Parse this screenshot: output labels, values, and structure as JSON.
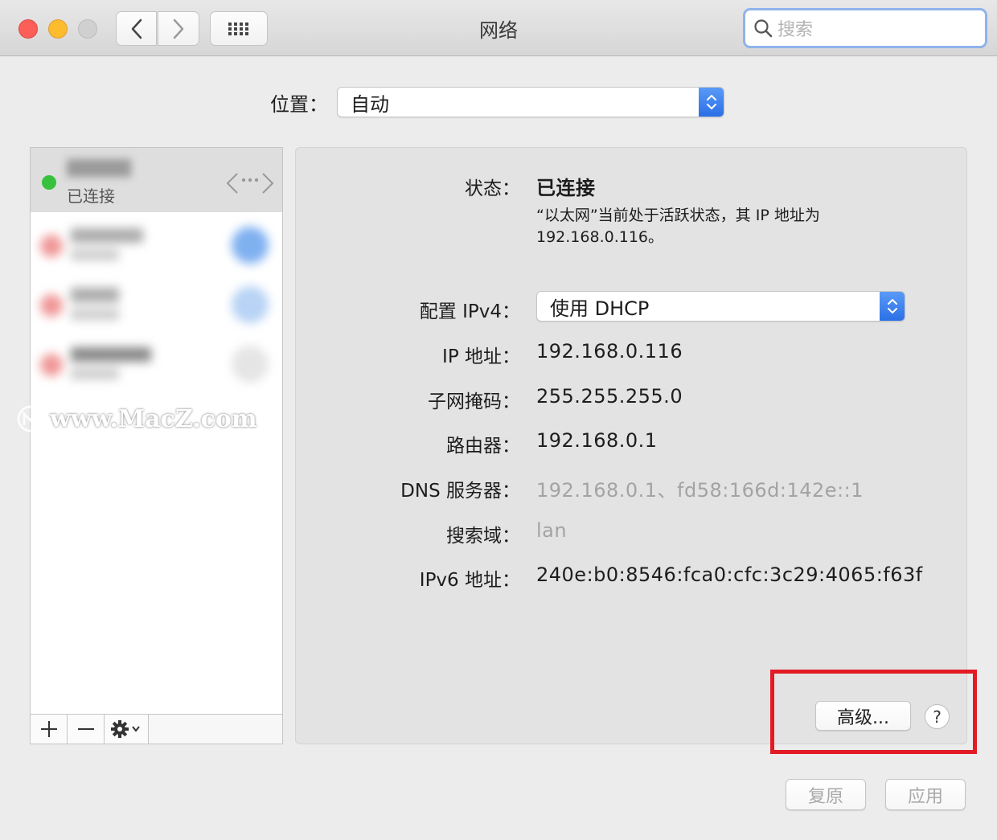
{
  "window": {
    "title": "网络",
    "search_placeholder": "搜索"
  },
  "location": {
    "label": "位置：",
    "value": "自动"
  },
  "sidebar": {
    "selected_item": {
      "status": "已连接",
      "status_color": "#38c13d"
    },
    "toolbar": {
      "add": "+",
      "remove": "—"
    }
  },
  "watermark": {
    "text": "www.MacZ.com"
  },
  "details": {
    "status_label": "状态：",
    "status_value": "已连接",
    "description_line1": "“以太网”当前处于活跃状态，其 IP 地址为",
    "description_line2": "192.168.0.116。",
    "config_ipv4_label": "配置 IPv4：",
    "config_ipv4_value": "使用 DHCP",
    "ip_label": "IP 地址：",
    "ip_value": "192.168.0.116",
    "subnet_label": "子网掩码：",
    "subnet_value": "255.255.255.0",
    "router_label": "路由器：",
    "router_value": "192.168.0.1",
    "dns_label": "DNS 服务器：",
    "dns_value": "192.168.0.1、fd58:166d:142e::1",
    "search_domain_label": "搜索域：",
    "search_domain_value": "lan",
    "ipv6_label": "IPv6 地址：",
    "ipv6_value": "240e:b0:8546:fca0:cfc:3c29:4065:f63f"
  },
  "buttons": {
    "advanced": "高级...",
    "help": "?",
    "revert": "复原",
    "apply": "应用"
  },
  "colors": {
    "highlight_box": "#e21b24",
    "accent": "#2b6fe6"
  }
}
